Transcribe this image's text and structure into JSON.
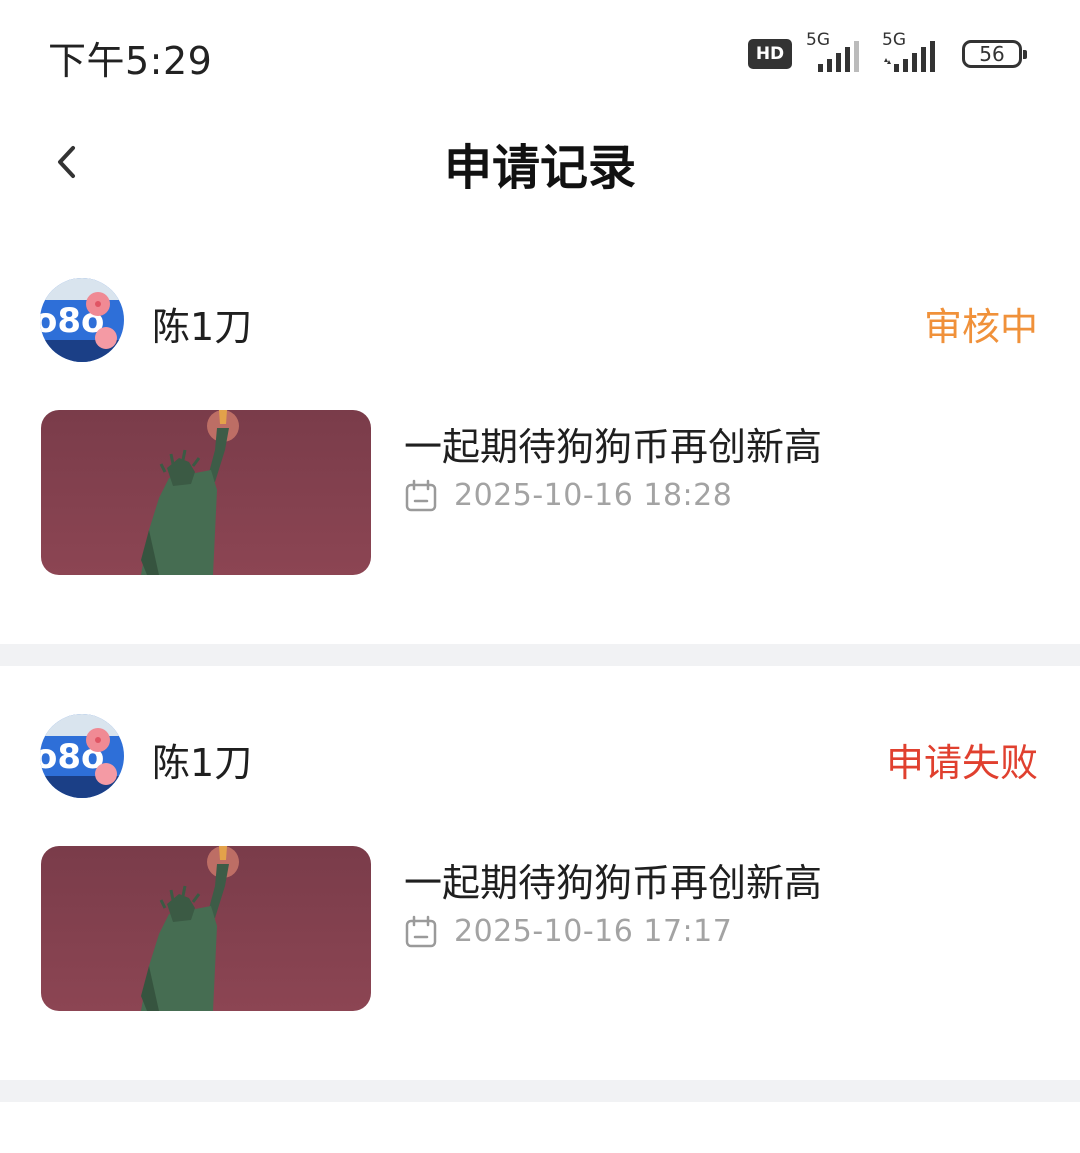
{
  "status_bar": {
    "time": "下午5:29",
    "hd_label": "HD",
    "network_1": "5G",
    "network_2": "5G",
    "battery": "56"
  },
  "header": {
    "title": "申请记录"
  },
  "colors": {
    "reviewing": "#f0913a",
    "failed": "#e0402f",
    "muted_text": "#a3a3a3",
    "divider": "#f1f2f4"
  },
  "records": [
    {
      "user_name": "陈1刀",
      "status": "审核中",
      "status_color": "#f0913a",
      "title": "一起期待狗狗币再创新高",
      "time": "2025-10-16 18:28",
      "thumbnail_icon": "statue-of-liberty-image",
      "avatar_icon": "user-avatar-image"
    },
    {
      "user_name": "陈1刀",
      "status": "申请失败",
      "status_color": "#e0402f",
      "title": "一起期待狗狗币再创新高",
      "time": "2025-10-16 17:17",
      "thumbnail_icon": "statue-of-liberty-image",
      "avatar_icon": "user-avatar-image"
    }
  ]
}
